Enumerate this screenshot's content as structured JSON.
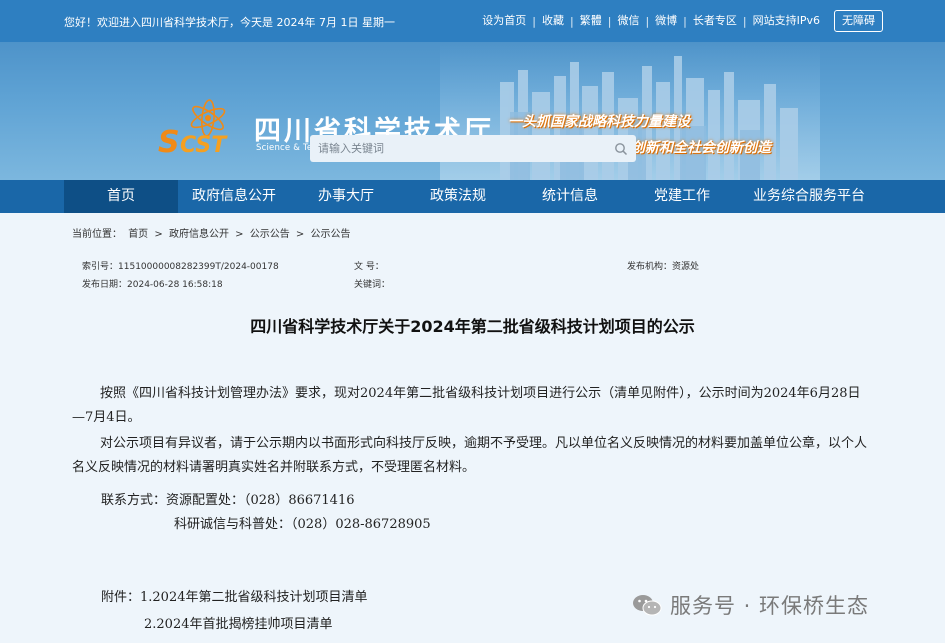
{
  "topbar": {
    "welcome": "您好！欢迎进入四川省科学技术厅，今天是  2024年 7月 1日  星期一",
    "links": [
      "设为首页",
      "收藏",
      "繁體",
      "微信",
      "微博",
      "长者专区",
      "网站支持IPv6"
    ],
    "separator": "|",
    "accessibility": "无障碍"
  },
  "header": {
    "logo_title": "四川省科学技术厅",
    "logo_subtitle": "Science & Technology Department of Sichuan Province",
    "slogan_1": "一头抓国家战略科技力量建设",
    "slogan_2": "一头抓产业技术创新和全社会创新创造"
  },
  "search": {
    "placeholder": "请输入关键词"
  },
  "nav": {
    "items": [
      "首页",
      "政府信息公开",
      "办事大厅",
      "政策法规",
      "统计信息",
      "党建工作",
      "业务综合服务平台"
    ]
  },
  "breadcrumb": {
    "label": "当前位置：",
    "items": [
      "首页",
      "政府信息公开",
      "公示公告",
      "公示公告"
    ],
    "sep": ">"
  },
  "meta": {
    "index_label": "索引号：",
    "index_value": "11510000008282399T/2024-00178",
    "docno_label": "文  号：",
    "org_label": "发布机构：",
    "org_value": "资源处",
    "date_label": "发布日期：",
    "date_value": "2024-06-28 16:58:18",
    "keywords_label": "关键词："
  },
  "doc": {
    "title": "四川省科学技术厅关于2024年第二批省级科技计划项目的公示",
    "para1": "按照《四川省科技计划管理办法》要求，现对2024年第二批省级科技计划项目进行公示（清单见附件），公示时间为2024年6月28日—7月4日。",
    "para2": "对公示项目有异议者，请于公示期内以书面形式向科技厅反映，逾期不予受理。凡以单位名义反映情况的材料要加盖单位公章，以个人名义反映情况的材料请署明真实姓名并附联系方式，不受理匿名材料。",
    "contact_line1": "联系方式：资源配置处：（028）86671416",
    "contact_line2": "科研诚信与科普处：（028）028-86728905",
    "attachment_line1": "附件：1.2024年第二批省级科技计划项目清单",
    "attachment_line2": "2.2024年首批揭榜挂帅项目清单"
  },
  "watermark": {
    "text": "服务号 · 环保桥生态"
  },
  "colors": {
    "topbar": "#2e7fc1",
    "nav": "#1a67a8",
    "nav_active": "#0e4f86",
    "content_bg": "#eef5fb",
    "logo_orange": "#f08a17"
  }
}
